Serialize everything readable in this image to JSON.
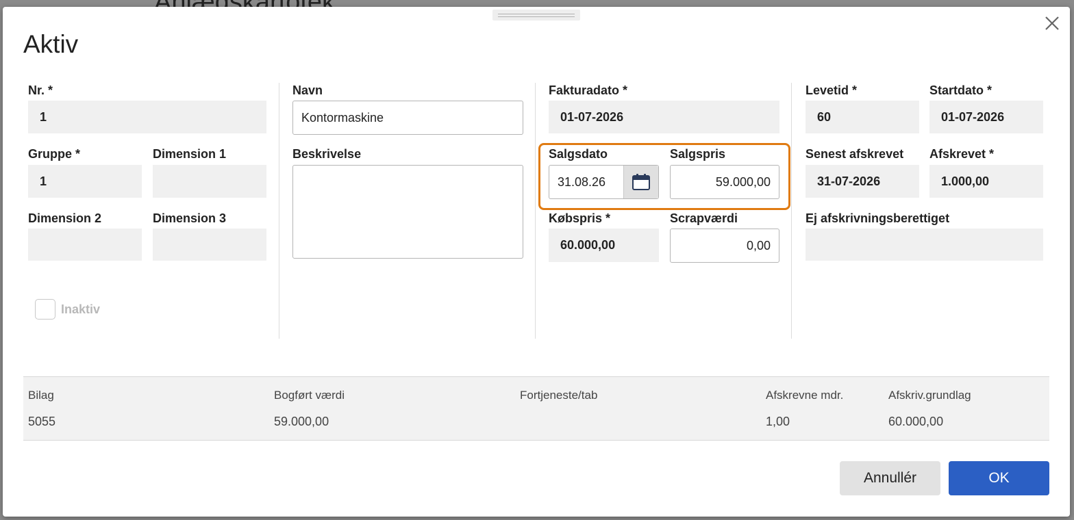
{
  "background": {
    "title": "Anlægskartotek"
  },
  "dialog": {
    "title": "Aktiv"
  },
  "fields": {
    "nr": {
      "label": "Nr. *",
      "value": "1"
    },
    "gruppe": {
      "label": "Gruppe *",
      "value": "1"
    },
    "dimension1": {
      "label": "Dimension 1",
      "value": ""
    },
    "dimension2": {
      "label": "Dimension 2",
      "value": ""
    },
    "dimension3": {
      "label": "Dimension 3",
      "value": ""
    },
    "inaktiv": {
      "label": "Inaktiv",
      "checked": false
    },
    "navn": {
      "label": "Navn",
      "value": "Kontormaskine"
    },
    "beskrivelse": {
      "label": "Beskrivelse",
      "value": ""
    },
    "fakturadato": {
      "label": "Fakturadato *",
      "value": "01-07-2026"
    },
    "salgsdato": {
      "label": "Salgsdato",
      "value": "31.08.26"
    },
    "salgspris": {
      "label": "Salgspris",
      "value": "59.000,00"
    },
    "koebspris": {
      "label": "Købspris *",
      "value": "60.000,00"
    },
    "scrapvaerdi": {
      "label": "Scrapværdi",
      "value": "0,00"
    },
    "levetid": {
      "label": "Levetid *",
      "value": "60"
    },
    "startdato": {
      "label": "Startdato *",
      "value": "01-07-2026"
    },
    "senest_afskrevet": {
      "label": "Senest afskrevet",
      "value": "31-07-2026"
    },
    "afskrevet": {
      "label": "Afskrevet *",
      "value": "1.000,00"
    },
    "ej_afskrivningsberettiget": {
      "label": "Ej afskrivningsberettiget",
      "value": ""
    }
  },
  "summary": {
    "headers": [
      "Bilag",
      "Bogført værdi",
      "Fortjeneste/tab",
      "Afskrevne mdr.",
      "Afskriv.grundlag"
    ],
    "values": [
      "5055",
      "59.000,00",
      "",
      "1,00",
      "60.000,00"
    ]
  },
  "buttons": {
    "cancel": "Annullér",
    "ok": "OK"
  },
  "colors": {
    "highlight": "#e07b12",
    "primary": "#2b5fc4"
  },
  "icons": {
    "close": "close-icon",
    "calendar": "calendar-icon"
  }
}
